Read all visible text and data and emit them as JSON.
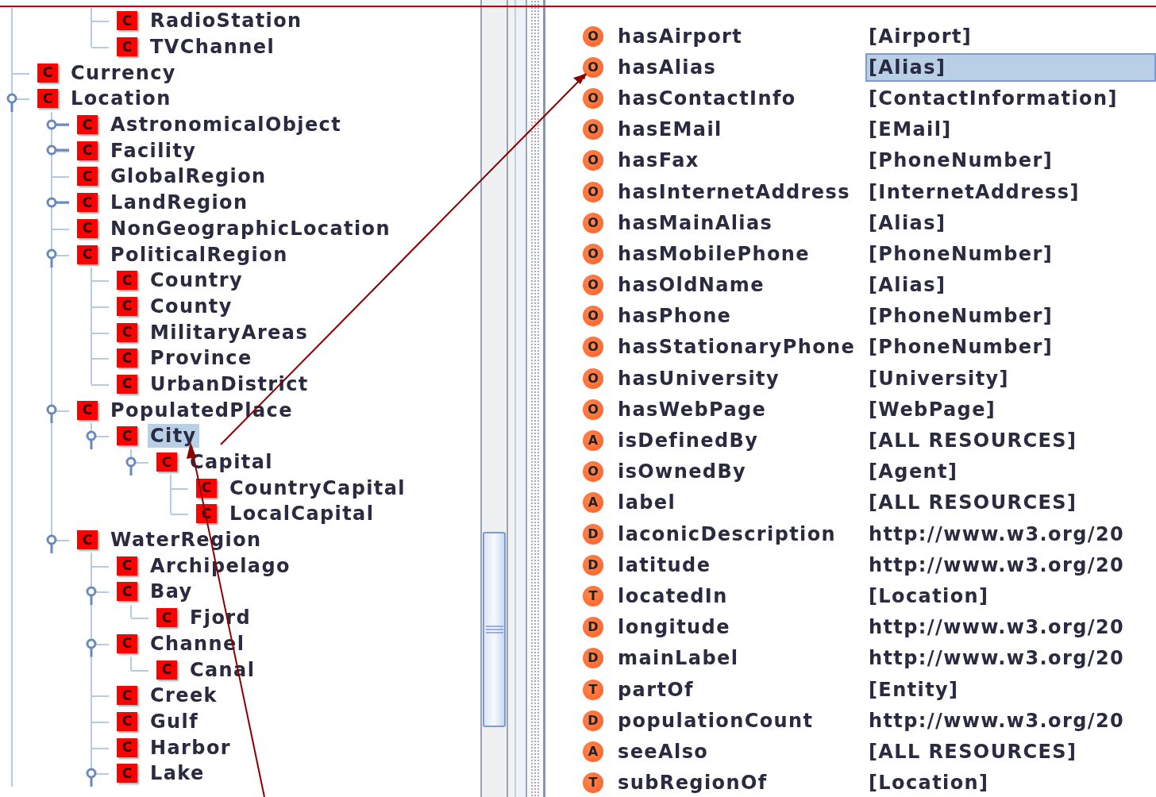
{
  "tree": {
    "cut_branch": [
      {
        "icon": "C",
        "label": "RadioStation",
        "selected": false
      },
      {
        "icon": "C",
        "label": "TVChannel",
        "selected": false
      }
    ],
    "nodes": [
      {
        "icon": "C",
        "label": "Currency",
        "selected": false
      },
      {
        "icon": "C",
        "label": "Location",
        "selected": false,
        "expanded": true,
        "children": [
          {
            "icon": "C",
            "label": "AstronomicalObject",
            "selected": false,
            "expanded": false
          },
          {
            "icon": "C",
            "label": "Facility",
            "selected": false,
            "expanded": false
          },
          {
            "icon": "C",
            "label": "GlobalRegion",
            "selected": false
          },
          {
            "icon": "C",
            "label": "LandRegion",
            "selected": false,
            "expanded": false
          },
          {
            "icon": "C",
            "label": "NonGeographicLocation",
            "selected": false
          },
          {
            "icon": "C",
            "label": "PoliticalRegion",
            "selected": false,
            "expanded": true,
            "children": [
              {
                "icon": "C",
                "label": "Country",
                "selected": false
              },
              {
                "icon": "C",
                "label": "County",
                "selected": false
              },
              {
                "icon": "C",
                "label": "MilitaryAreas",
                "selected": false
              },
              {
                "icon": "C",
                "label": "Province",
                "selected": false
              },
              {
                "icon": "C",
                "label": "UrbanDistrict",
                "selected": false
              }
            ]
          },
          {
            "icon": "C",
            "label": "PopulatedPlace",
            "selected": false,
            "expanded": true,
            "children": [
              {
                "icon": "C",
                "label": "City",
                "selected": true,
                "expanded": true,
                "children": [
                  {
                    "icon": "C",
                    "label": "Capital",
                    "selected": false,
                    "expanded": true,
                    "children": [
                      {
                        "icon": "C",
                        "label": "CountryCapital",
                        "selected": false
                      },
                      {
                        "icon": "C",
                        "label": "LocalCapital",
                        "selected": false
                      }
                    ]
                  }
                ]
              }
            ]
          },
          {
            "icon": "C",
            "label": "WaterRegion",
            "selected": false,
            "expanded": true,
            "children": [
              {
                "icon": "C",
                "label": "Archipelago",
                "selected": false
              },
              {
                "icon": "C",
                "label": "Bay",
                "selected": false,
                "expanded": true,
                "children": [
                  {
                    "icon": "C",
                    "label": "Fjord",
                    "selected": false
                  }
                ]
              },
              {
                "icon": "C",
                "label": "Channel",
                "selected": false,
                "expanded": true,
                "children": [
                  {
                    "icon": "C",
                    "label": "Canal",
                    "selected": false
                  }
                ]
              },
              {
                "icon": "C",
                "label": "Creek",
                "selected": false
              },
              {
                "icon": "C",
                "label": "Gulf",
                "selected": false
              },
              {
                "icon": "C",
                "label": "Harbor",
                "selected": false
              },
              {
                "icon": "C",
                "label": "Lake",
                "selected": false,
                "expanded": true
              }
            ]
          }
        ]
      }
    ]
  },
  "properties": [
    {
      "icon": "O",
      "name": "hasAirport",
      "range": "[Airport]",
      "selected": false
    },
    {
      "icon": "O",
      "name": "hasAlias",
      "range": "[Alias]",
      "selected": true
    },
    {
      "icon": "O",
      "name": "hasContactInfo",
      "range": "[ContactInformation]",
      "selected": false
    },
    {
      "icon": "O",
      "name": "hasEMail",
      "range": "[EMail]",
      "selected": false
    },
    {
      "icon": "O",
      "name": "hasFax",
      "range": "[PhoneNumber]",
      "selected": false
    },
    {
      "icon": "O",
      "name": "hasInternetAddress",
      "range": "[InternetAddress]",
      "selected": false
    },
    {
      "icon": "O",
      "name": "hasMainAlias",
      "range": "[Alias]",
      "selected": false
    },
    {
      "icon": "O",
      "name": "hasMobilePhone",
      "range": "[PhoneNumber]",
      "selected": false
    },
    {
      "icon": "O",
      "name": "hasOldName",
      "range": "[Alias]",
      "selected": false
    },
    {
      "icon": "O",
      "name": "hasPhone",
      "range": "[PhoneNumber]",
      "selected": false
    },
    {
      "icon": "O",
      "name": "hasStationaryPhone",
      "range": "[PhoneNumber]",
      "selected": false
    },
    {
      "icon": "O",
      "name": "hasUniversity",
      "range": "[University]",
      "selected": false
    },
    {
      "icon": "O",
      "name": "hasWebPage",
      "range": "[WebPage]",
      "selected": false
    },
    {
      "icon": "A",
      "name": "isDefinedBy",
      "range": "[ALL RESOURCES]",
      "selected": false
    },
    {
      "icon": "O",
      "name": "isOwnedBy",
      "range": "[Agent]",
      "selected": false
    },
    {
      "icon": "A",
      "name": "label",
      "range": "[ALL RESOURCES]",
      "selected": false
    },
    {
      "icon": "D",
      "name": "laconicDescription",
      "range": "http://www.w3.org/20",
      "selected": false
    },
    {
      "icon": "D",
      "name": "latitude",
      "range": "http://www.w3.org/20",
      "selected": false
    },
    {
      "icon": "T",
      "name": "locatedIn",
      "range": "[Location]",
      "selected": false
    },
    {
      "icon": "D",
      "name": "longitude",
      "range": "http://www.w3.org/20",
      "selected": false
    },
    {
      "icon": "D",
      "name": "mainLabel",
      "range": "http://www.w3.org/20",
      "selected": false
    },
    {
      "icon": "T",
      "name": "partOf",
      "range": "[Entity]",
      "selected": false
    },
    {
      "icon": "D",
      "name": "populationCount",
      "range": "http://www.w3.org/20",
      "selected": false
    },
    {
      "icon": "A",
      "name": "seeAlso",
      "range": "[ALL RESOURCES]",
      "selected": false
    },
    {
      "icon": "T",
      "name": "subRegionOf",
      "range": "[Location]",
      "selected": false
    }
  ]
}
